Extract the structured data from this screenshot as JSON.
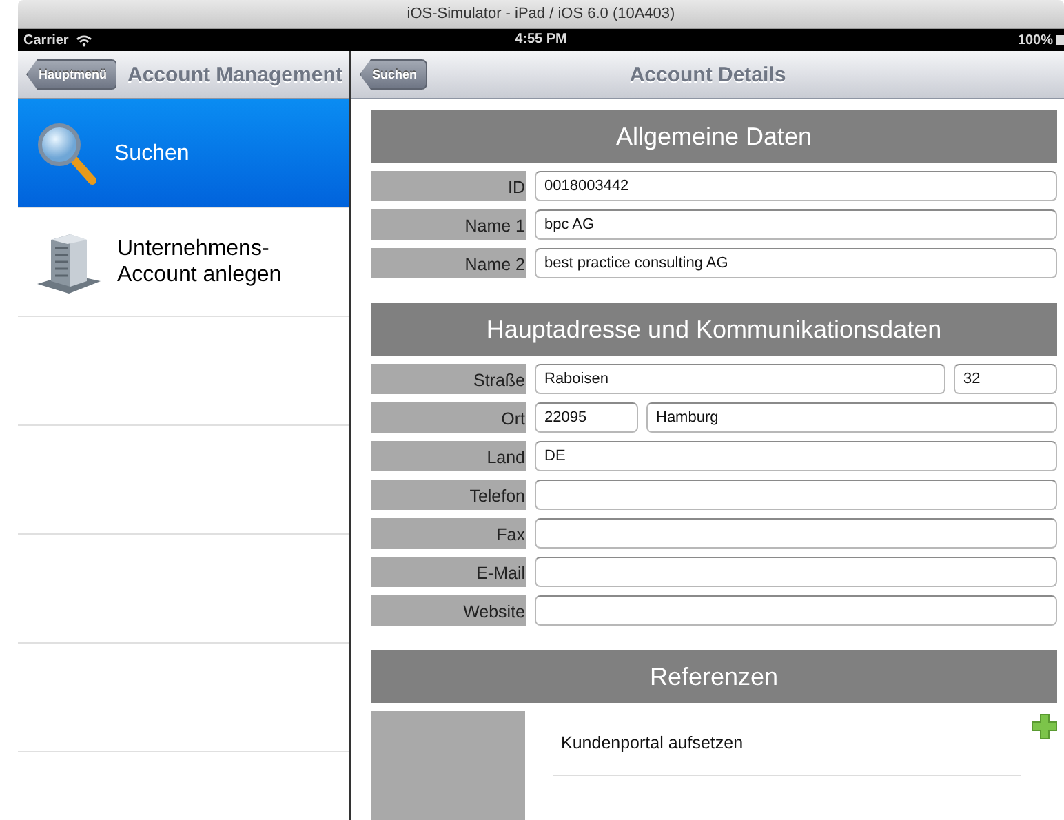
{
  "window": {
    "title": "iOS-Simulator - iPad / iOS 6.0 (10A403)"
  },
  "status_bar": {
    "carrier": "Carrier",
    "time": "4:55 PM",
    "battery": "100%"
  },
  "sidebar": {
    "back_button": "Hauptmenü",
    "title": "Account Management",
    "items": [
      {
        "label": "Suchen",
        "kind": "search",
        "selected": true
      },
      {
        "label": "Unternehmens-\nAccount anlegen",
        "kind": "create",
        "selected": false
      }
    ]
  },
  "detail": {
    "back_button": "Suchen",
    "title": "Account Details",
    "sections": [
      {
        "title": "Allgemeine Daten",
        "rows": [
          {
            "label": "ID",
            "fields": [
              {
                "value": "0018003442",
                "kind": "long"
              }
            ]
          },
          {
            "label": "Name 1",
            "fields": [
              {
                "value": "bpc AG",
                "kind": "long"
              }
            ]
          },
          {
            "label": "Name 2",
            "fields": [
              {
                "value": "best practice consulting AG",
                "kind": "long"
              }
            ]
          }
        ]
      },
      {
        "title": "Hauptadresse und Kommunikationsdaten",
        "rows": [
          {
            "label": "Straße",
            "fields": [
              {
                "value": "Raboisen",
                "kind": "long"
              },
              {
                "value": "32",
                "kind": "short"
              }
            ]
          },
          {
            "label": "Ort",
            "fields": [
              {
                "value": "22095",
                "kind": "short"
              },
              {
                "value": "Hamburg",
                "kind": "long"
              }
            ]
          },
          {
            "label": "Land",
            "fields": [
              {
                "value": "DE",
                "kind": "long"
              }
            ]
          },
          {
            "label": "Telefon",
            "fields": [
              {
                "kind": "long"
              }
            ]
          },
          {
            "label": "Fax",
            "fields": [
              {
                "kind": "long"
              }
            ]
          },
          {
            "label": "E-Mail",
            "fields": [
              {
                "kind": "long"
              }
            ]
          },
          {
            "label": "Website",
            "fields": [
              {
                "kind": "long"
              }
            ]
          }
        ]
      },
      {
        "title": "Referenzen",
        "references": [
          {
            "label": "Kundenportal aufsetzen"
          }
        ]
      }
    ]
  }
}
